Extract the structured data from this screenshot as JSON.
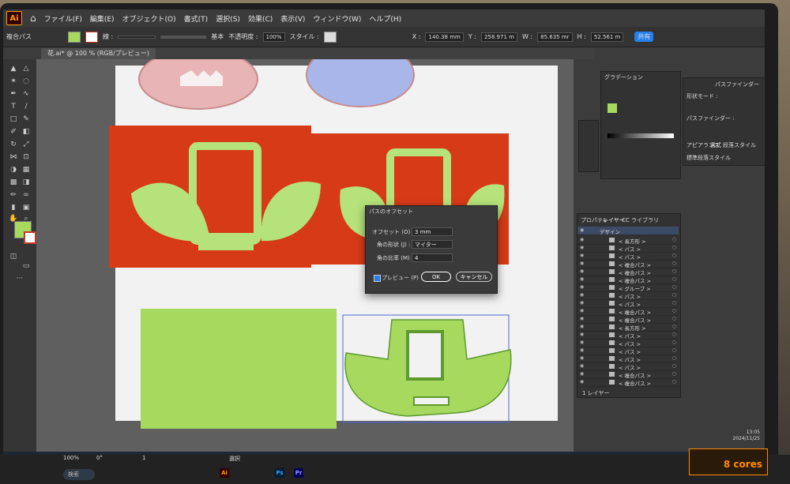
{
  "menubar": {
    "app_logo": "Ai",
    "items": [
      "ファイル(F)",
      "編集(E)",
      "オブジェクト(O)",
      "書式(T)",
      "選択(S)",
      "効果(C)",
      "表示(V)",
      "ウィンドウ(W)",
      "ヘルプ(H)"
    ]
  },
  "controlbar": {
    "selection_label": "複合パス",
    "stroke_label": "線 :",
    "stroke_style": "基本",
    "opacity_label": "不透明度 :",
    "opacity_value": "100%",
    "style_label": "スタイル :",
    "x_label": "X :",
    "x_value": "140.38 mm",
    "y_label": "Y :",
    "y_value": "258.971 m",
    "w_label": "W :",
    "w_value": "85.635 mr",
    "h_label": "H :",
    "h_value": "52.561 m",
    "share_label": "共有"
  },
  "document_tab": "花.ai* @ 100 % (RGB/プレビュー)",
  "colors": {
    "fill": "#a6d95e",
    "art_red": "#d63a17",
    "leaf_green": "#b5e27a",
    "dialog_ok": "#2680eb"
  },
  "dialog": {
    "title": "パスのオフセット",
    "offset_label": "オフセット (O) :",
    "offset_value": "3 mm",
    "join_label": "角の形状 (J) :",
    "join_value": "マイター",
    "miter_label": "角の比率 (M) :",
    "miter_value": "4",
    "preview_label": "プレビュー (P)",
    "ok_label": "OK",
    "cancel_label": "キャンセル"
  },
  "panels": {
    "gradient_title": "グラデーション",
    "pathfinder_title": "パスファインダー",
    "shape_mode_label": "形状モード :",
    "pathfinder_label": "パスファインダー :",
    "appearance_tabs": [
      "アピアランス",
      "書式",
      "段落スタイル"
    ],
    "default_style": "標準段落スタイル",
    "layers_tabs": [
      "プロパティ",
      "レイヤー",
      "CC ライブラリ"
    ],
    "layers_footer": "1 レイヤー",
    "layer_root": "デザイン",
    "layer_items": [
      "< 長方形 >",
      "< パス >",
      "< パス >",
      "< 複合パス >",
      "< 複合パス >",
      "< 複合パス >",
      "< グループ >",
      "< パス >",
      "< パス >",
      "< 複合パス >",
      "< 複合パス >",
      "< 長方形 >",
      "< パス >",
      "< パス >",
      "< パス >",
      "< パス >",
      "< パス >",
      "< 複合パス >",
      "< 複合パス >"
    ]
  },
  "status": {
    "zoom": "100%",
    "rotation": "0°",
    "artboard": "1",
    "tool": "選択"
  },
  "taskbar": {
    "search_placeholder": "検索",
    "time": "13:05",
    "date": "2024/11/25"
  },
  "badge": "8 cores"
}
